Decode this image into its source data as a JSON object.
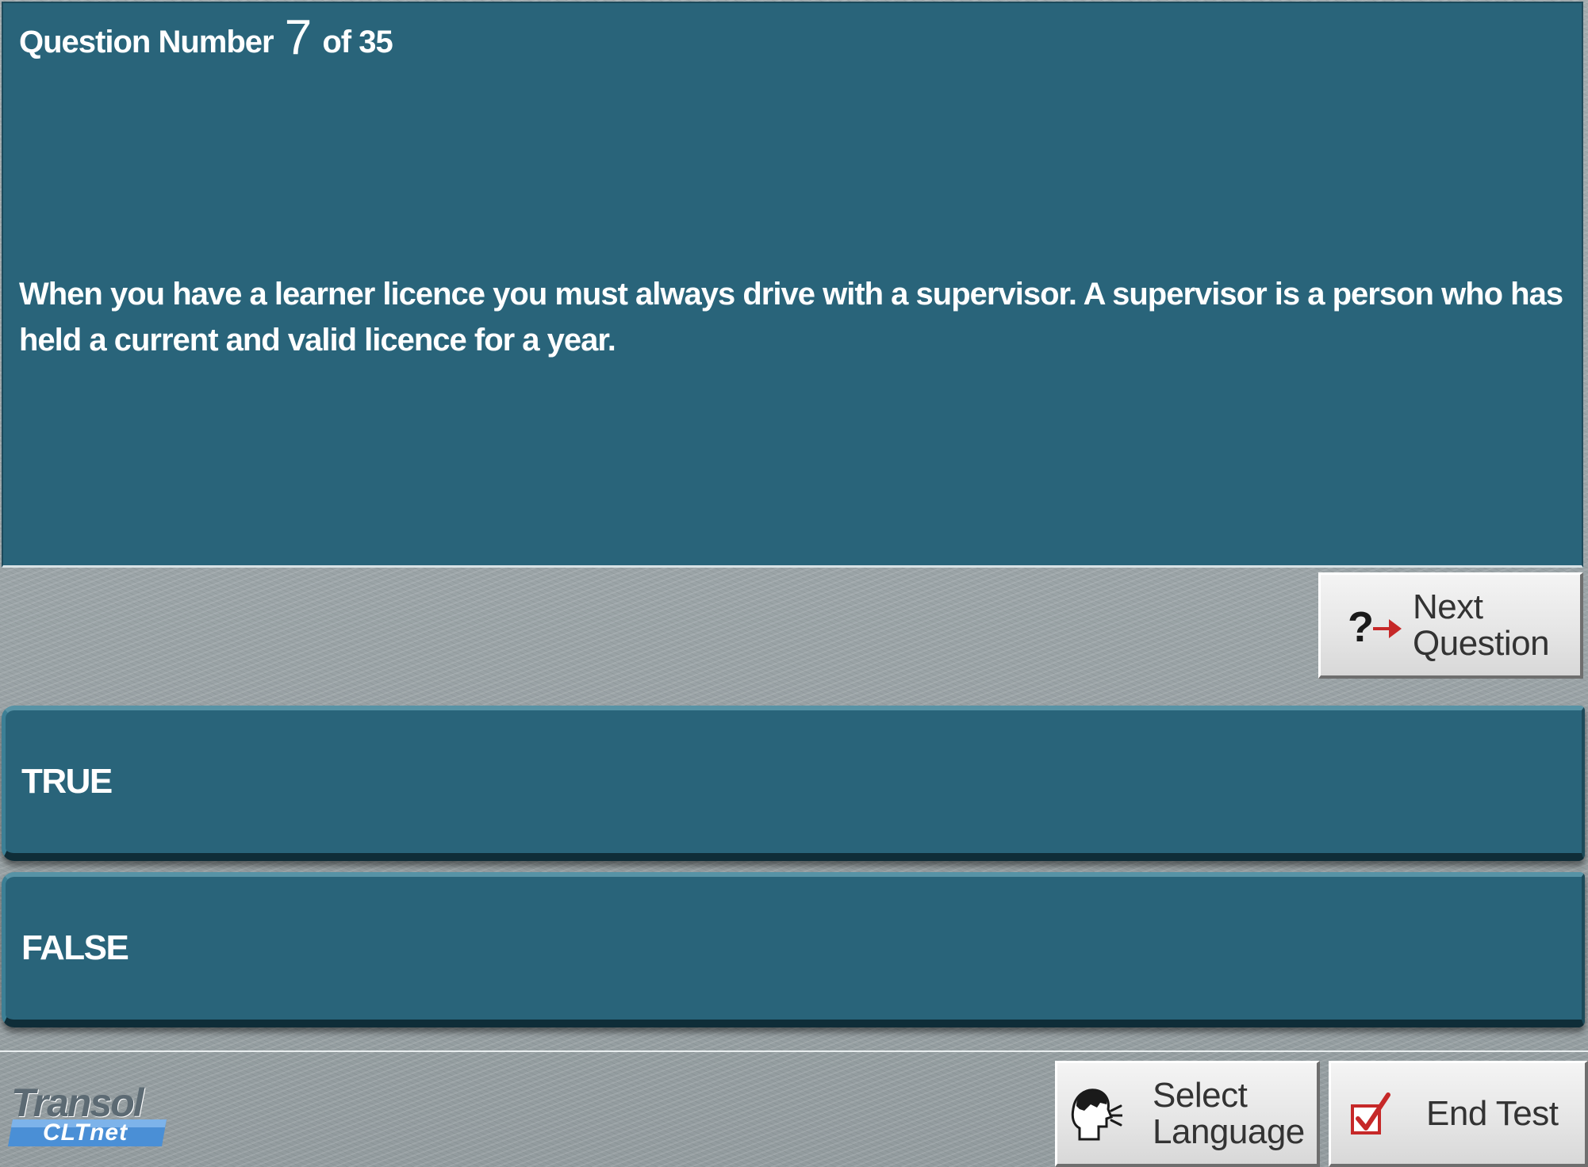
{
  "question": {
    "header_prefix": "Question Number",
    "number": "7",
    "header_suffix": "of 35",
    "text": "When you have a learner licence you must always drive with a supervisor. A supervisor is a person who has held a current and valid licence for a year."
  },
  "buttons": {
    "next_question": "Next Question",
    "select_language": "Select Language",
    "end_test": "End Test"
  },
  "answers": [
    {
      "label": "TRUE"
    },
    {
      "label": "FALSE"
    }
  ],
  "logo": {
    "main": "Transol",
    "sub": "CLTnet"
  },
  "icons": {
    "next": "question-arrow-icon",
    "language": "speaking-head-icon",
    "end": "checkbox-check-icon"
  },
  "colors": {
    "panel": "#29647a",
    "background": "#9aa3a6",
    "button": "#e6e6e6",
    "accent_red": "#c62828"
  }
}
